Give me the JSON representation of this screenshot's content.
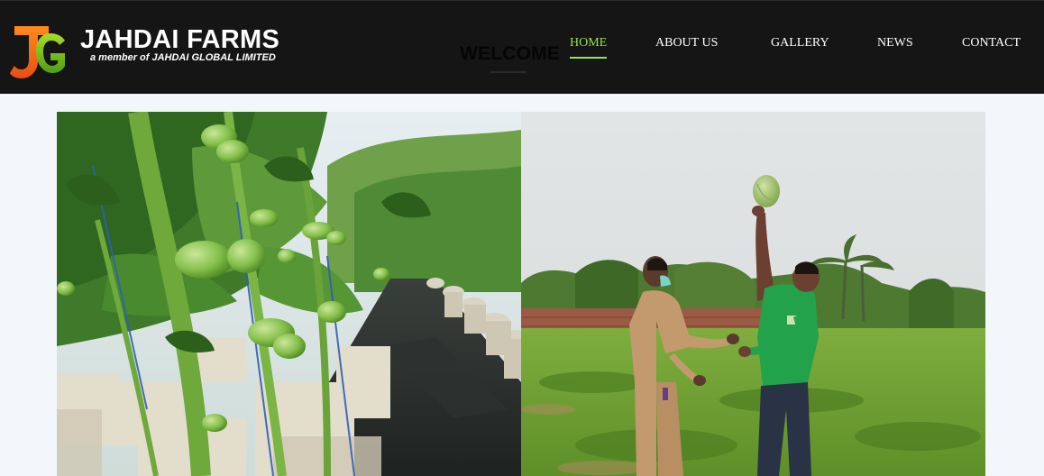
{
  "brand": {
    "logo_icon": "jg-monogram-logo",
    "name": "JAHDAI FARMS",
    "tagline": "a member of JAHDAI GLOBAL LIMITED"
  },
  "hero": {
    "heading": "WELCOME"
  },
  "nav": {
    "items": [
      {
        "label": "HOME",
        "active": true
      },
      {
        "label": "ABOUT US",
        "active": false
      },
      {
        "label": "GALLERY",
        "active": false
      },
      {
        "label": "NEWS",
        "active": false
      },
      {
        "label": "CONTACT",
        "active": false
      }
    ]
  },
  "colors": {
    "header_bg": "#151515",
    "nav_active": "#9be34a",
    "page_bg": "#f3f6fb"
  },
  "gallery": {
    "images": [
      {
        "subject": "greenhouse-tomato-plants-photo"
      },
      {
        "subject": "farm-workers-watermelon-field-photo"
      }
    ]
  }
}
